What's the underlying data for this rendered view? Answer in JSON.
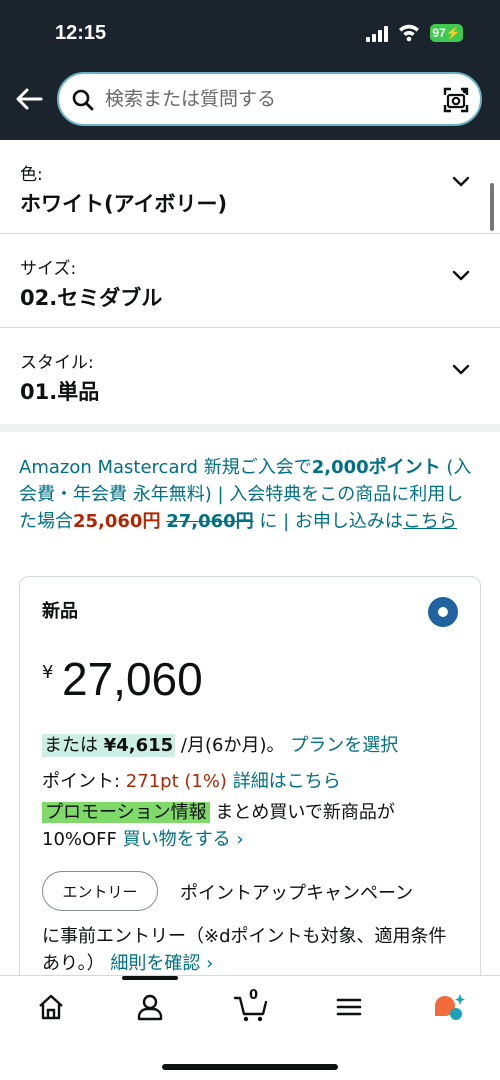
{
  "status_bar": {
    "time": "12:15",
    "battery": "97"
  },
  "header": {
    "search_placeholder": "検索または質問する"
  },
  "options": [
    {
      "label": "色:",
      "value": "ホワイト(アイボリー)"
    },
    {
      "label": "サイズ:",
      "value": "02.セミダブル"
    },
    {
      "label": "スタイル:",
      "value": "01.単品"
    }
  ],
  "promo": {
    "part1": "Amazon Mastercard 新規ご入会で",
    "points": "2,000ポイント",
    "part2": " (入会費・年会費 永年無料) | 入会特典をこの商品に利用した場合",
    "discounted_price": "25,060円",
    "original_price": "27,060円",
    "part3": " に | お申し込みは",
    "link": "こちら"
  },
  "offer": {
    "condition": "新品",
    "currency": "¥",
    "price": "27,060",
    "installment_prefix": "または ",
    "installment_amount": "¥4,615",
    "installment_suffix": " /月(6か月)。",
    "plan_link": "プランを選択",
    "points_label": "ポイント: ",
    "points_value": "271pt  (1%)",
    "points_link": "詳細はこちら",
    "promo_tag": "プロモーション情報",
    "promo_text": " まとめ買いで新商品が10%OFF ",
    "promo_link": "買い物をする ›",
    "entry_button": "エントリー",
    "entry_text": "ポイントアップキャンペーン",
    "entry_text2": "に事前エントリー（※dポイントも対象、適用条件あり。）",
    "entry_link": "細則を確認 ›"
  },
  "bottom_nav": {
    "cart_count": "0",
    "icons": [
      "home-icon",
      "account-icon",
      "cart-icon",
      "menu-icon",
      "rufus-icon"
    ]
  },
  "colors": {
    "header_bg": "#1b232c",
    "link": "#007185",
    "price_red": "#b12704",
    "radio": "#2162a1",
    "promo_tag": "#7fda69",
    "installment_highlight": "#cdeee3"
  }
}
